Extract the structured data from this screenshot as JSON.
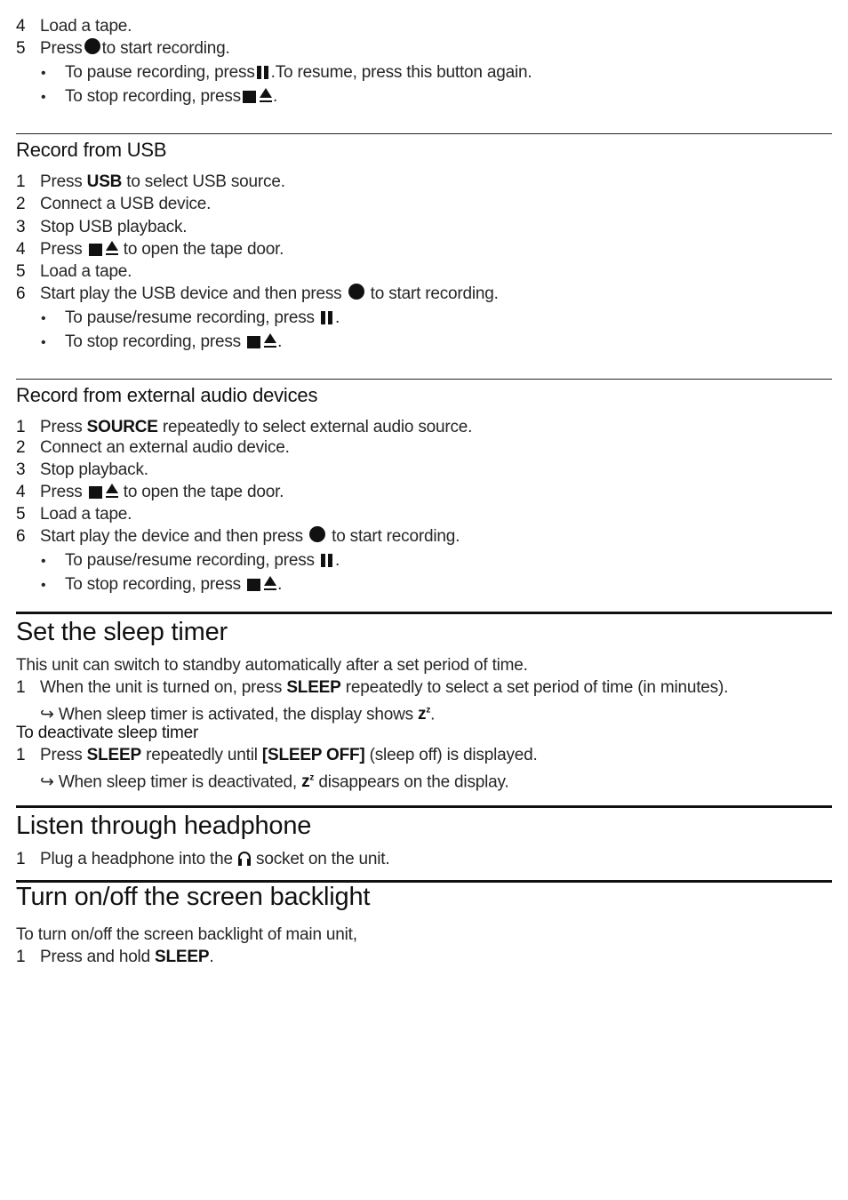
{
  "top_steps": [
    {
      "num": "4",
      "text": "Load a tape."
    },
    {
      "num": "5",
      "pre": "Press",
      "post": "to start recording."
    }
  ],
  "top_bullets": [
    {
      "pre": "To pause recording, press",
      "post": ".To resume, press this button again."
    },
    {
      "pre": "To stop recording, press",
      "post": "."
    }
  ],
  "usb": {
    "title": "Record from USB",
    "steps": [
      {
        "num": "1",
        "pre": "Press",
        "bold": "USB",
        "post": "to select USB source."
      },
      {
        "num": "2",
        "text": "Connect a USB device."
      },
      {
        "num": "3",
        "text": "Stop USB playback."
      },
      {
        "num": "4",
        "pre": "Press",
        "post": "to open the tape door."
      },
      {
        "num": "5",
        "text": "Load a tape."
      },
      {
        "num": "6",
        "pre": "Start play the USB device and then press",
        "post": "to start recording."
      }
    ],
    "bullets": [
      {
        "pre": "To pause/resume recording, press",
        "post": "."
      },
      {
        "pre": "To stop recording, press",
        "post": "."
      }
    ]
  },
  "external": {
    "title": "Record from external audio devices",
    "steps": [
      {
        "num": "1",
        "pre": "Press",
        "bold": "SOURCE",
        "post": "repeatedly to select external audio source."
      },
      {
        "num": "2",
        "text": "Connect an external audio device."
      },
      {
        "num": "3",
        "text": "Stop playback."
      },
      {
        "num": "4",
        "pre": "Press",
        "post": "to open the tape door."
      },
      {
        "num": "5",
        "text": "Load a tape."
      },
      {
        "num": "6",
        "pre": "Start play the device and then press",
        "post": "to start recording."
      }
    ],
    "bullets": [
      {
        "pre": "To pause/resume recording, press",
        "post": "."
      },
      {
        "pre": "To stop recording, press",
        "post": "."
      }
    ]
  },
  "sleep": {
    "title": "Set the sleep timer",
    "intro": "This unit can switch to standby automatically after a set period of time.",
    "step1": {
      "num": "1",
      "pre": "When the unit is turned on, press",
      "bold": "SLEEP",
      "post": "repeatedly to select a set period of time (in minutes)."
    },
    "result1": {
      "arrow": "↪",
      "pre": "When sleep timer is activated, the display shows",
      "post": "."
    },
    "deactivate_title": "To deactivate sleep timer",
    "step2": {
      "num": "1",
      "pre": "Press",
      "bold": "SLEEP",
      "mid": "repeatedly until",
      "bold2": "[SLEEP OFF]",
      "post": "(sleep off) is displayed."
    },
    "result2": {
      "arrow": "↪",
      "pre": "When sleep timer is deactivated,",
      "post": "disappears on the display."
    },
    "zz_symbol": "z",
    "zz_sup": "z"
  },
  "headphone": {
    "title": "Listen through headphone",
    "step1": {
      "num": "1",
      "pre": "Plug a headphone into the",
      "post": "socket on the unit."
    }
  },
  "backlight": {
    "title": "Turn on/off the screen backlight",
    "intro": "To turn on/off the screen backlight of main unit,",
    "step1": {
      "num": "1",
      "pre": "Press and hold",
      "bold": "SLEEP",
      "post": "."
    }
  },
  "bullet_char": "•"
}
